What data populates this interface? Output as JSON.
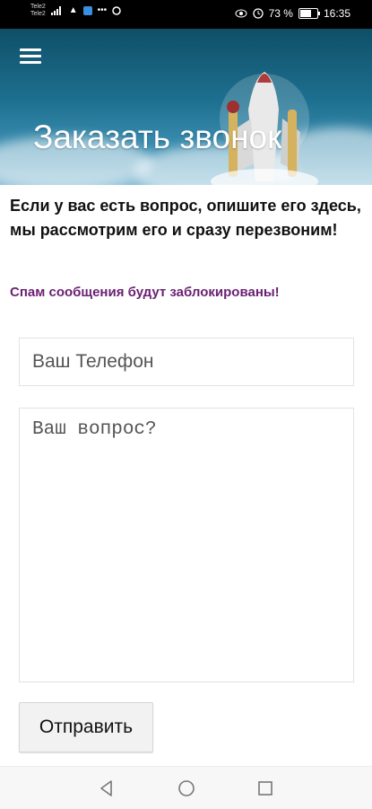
{
  "status_bar": {
    "carrier1": "Tele2",
    "carrier2": "Tele2",
    "battery_percent": "73 %",
    "battery_level": 0.73,
    "time": "16:35"
  },
  "header": {
    "title": "Заказать звонок"
  },
  "content": {
    "intro_text": "Если у вас есть вопрос, опишите его здесь, мы рассмотрим его и сразу перезвоним!",
    "spam_warning": "Спам сообщения будут заблокированы!",
    "spam_color": "#6b1f73"
  },
  "form": {
    "phone_placeholder": "Ваш Телефон",
    "question_placeholder": "Ваш вопрос?",
    "submit_label": "Отправить"
  },
  "icons": [
    "menu-icon",
    "rocket-image",
    "back-icon",
    "home-icon",
    "recents-icon",
    "signal-icon",
    "wifi-icon",
    "alarm-icon",
    "battery-icon"
  ]
}
